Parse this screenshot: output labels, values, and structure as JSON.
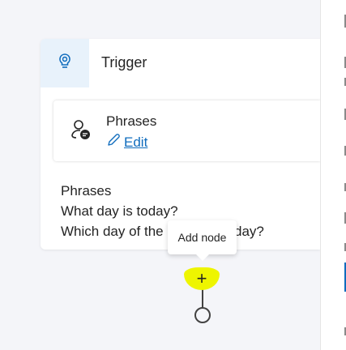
{
  "trigger": {
    "title": "Trigger"
  },
  "phrases_node": {
    "title": "Phrases",
    "edit_label": "Edit"
  },
  "summary": {
    "heading": "Phrases",
    "lines": [
      "What day is today?",
      "Which day of the",
      "day?"
    ]
  },
  "tooltip": {
    "label": "Add node"
  },
  "colors": {
    "accent": "#0f6cbd",
    "highlight": "#eef500",
    "header_bg": "#e8f2fb",
    "canvas_bg": "#f4f5f9"
  },
  "icons": {
    "trigger": "lightbulb-icon",
    "phrases": "person-chat-icon",
    "edit": "pencil-icon",
    "add": "plus-icon"
  }
}
